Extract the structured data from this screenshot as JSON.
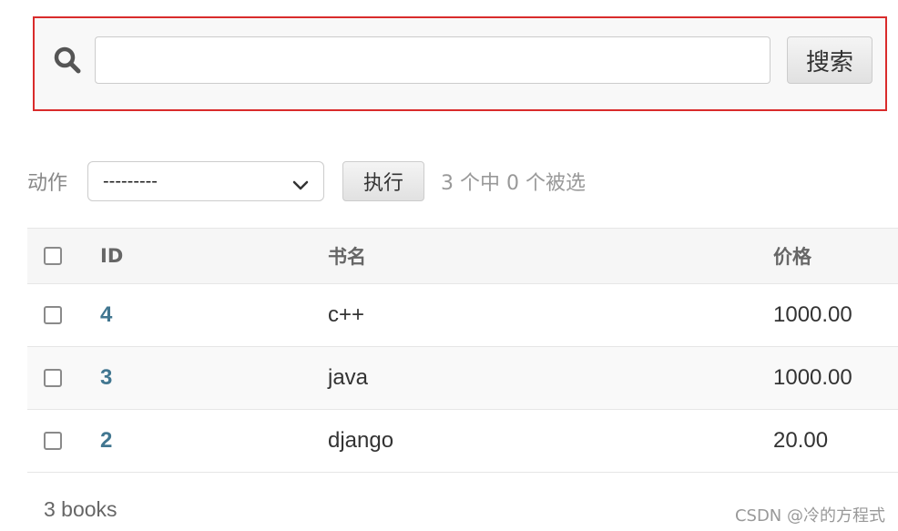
{
  "search": {
    "value": "",
    "placeholder": "",
    "button_label": "搜索",
    "icon": "search-icon"
  },
  "actions": {
    "label": "动作",
    "select_value": "---------",
    "run_label": "执行",
    "counter": "3 个中 0 个被选"
  },
  "table": {
    "columns": {
      "id": "ID",
      "name": "书名",
      "price": "价格"
    },
    "rows": [
      {
        "id": "4",
        "name": "c++",
        "price": "1000.00"
      },
      {
        "id": "3",
        "name": "java",
        "price": "1000.00"
      },
      {
        "id": "2",
        "name": "django",
        "price": "20.00"
      }
    ]
  },
  "footer": {
    "count": "3 books"
  },
  "watermark": "CSDN @冷的方程式",
  "colors": {
    "highlight_border": "#d92b2b",
    "link": "#417690"
  }
}
